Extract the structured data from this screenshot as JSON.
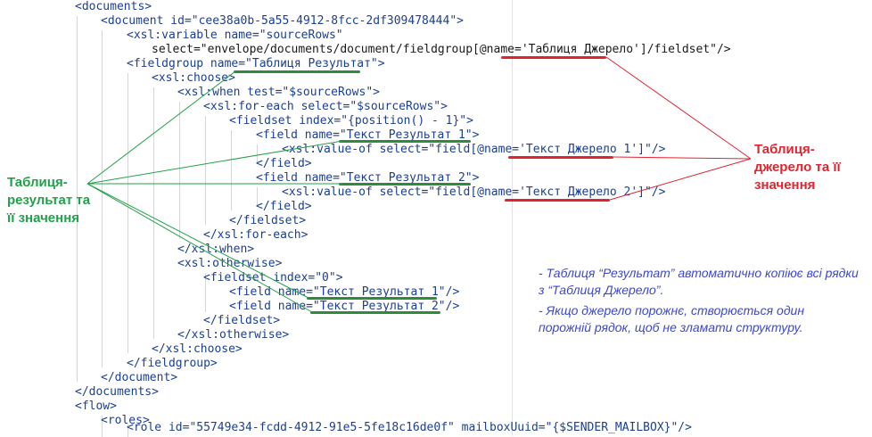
{
  "code_lines": [
    {
      "text": "<documents>"
    },
    {
      "text": "<document id=\"cee38a0b-5a55-4912-8fcc-2df309478444\">"
    },
    {
      "text": "<xsl:variable name=\"sourceRows\""
    },
    {
      "text": "select=\"envelope/documents/document/fieldgroup[@name='Таблиця Джерело']/fieldset\"/>"
    },
    {
      "text": "<fieldgroup name=\"Таблиця Результат\">"
    },
    {
      "text": "<xsl:choose>"
    },
    {
      "text": "<xsl:when test=\"$sourceRows\">"
    },
    {
      "text": "<xsl:for-each select=\"$sourceRows\">"
    },
    {
      "text": "<fieldset index=\"{position() - 1}\">"
    },
    {
      "text": "<field name=\"Текст Результат 1\">"
    },
    {
      "text": "<xsl:value-of select=\"field[@name='Текст Джерело 1']\"/>"
    },
    {
      "text": "</field>"
    },
    {
      "text": "<field name=\"Текст Результат 2\">"
    },
    {
      "text": "<xsl:value-of select=\"field[@name='Текст Джерело 2']\"/>"
    },
    {
      "text": "</field>"
    },
    {
      "text": "</fieldset>"
    },
    {
      "text": "</xsl:for-each>"
    },
    {
      "text": "</xsl:when>"
    },
    {
      "text": "<xsl:otherwise>"
    },
    {
      "text": "<fieldset index=\"0\">"
    },
    {
      "text": "<field name=\"Текст Результат 1\"/>"
    },
    {
      "text": "<field name=\"Текст Результат 2\"/>"
    },
    {
      "text": "</fieldset>"
    },
    {
      "text": "</xsl:otherwise>"
    },
    {
      "text": "</xsl:choose>"
    },
    {
      "text": "</fieldgroup>"
    },
    {
      "text": "</document>"
    },
    {
      "text": "</documents>"
    },
    {
      "text": "<flow>"
    },
    {
      "text": "<roles>"
    },
    {
      "text": "<role id=\"55749e34-fcdd-4912-91e5-5fe18c16de0f\" mailboxUuid=\"{$SENDER_MAILBOX}\"/>"
    }
  ],
  "labels": {
    "result_table": "Таблиця-результат та її значення",
    "source_table": "Таблиця-джерело та її значення"
  },
  "notes": [
    "- Таблиця “Результат” автоматично копіює всі рядки з “Таблиця Джерело”.",
    "- Якщо джерело порожнє, створюється один порожній рядок, щоб не зламати структуру."
  ],
  "colors": {
    "result_accent": "#22a04a",
    "source_accent": "#e3232f",
    "note_text": "#3d49c9",
    "tag": "#1d3f8f"
  }
}
